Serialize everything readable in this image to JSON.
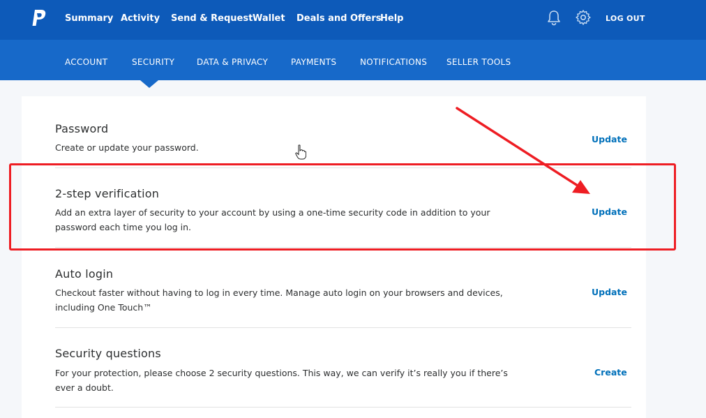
{
  "topnav": {
    "logo_icon": "paypal-logo",
    "items": [
      "Summary",
      "Activity",
      "Send & Request",
      "Wallet",
      "Deals and Offers",
      "Help"
    ],
    "bell_icon": "bell-icon",
    "gear_icon": "gear-icon",
    "logout": "LOG OUT"
  },
  "subnav": {
    "tabs": [
      "ACCOUNT",
      "SECURITY",
      "DATA & PRIVACY",
      "PAYMENTS",
      "NOTIFICATIONS",
      "SELLER TOOLS"
    ],
    "active": "SECURITY"
  },
  "settings": {
    "rows": [
      {
        "title": "Password",
        "desc": "Create or update your password.",
        "action": "Update"
      },
      {
        "title": "2-step verification",
        "desc": "Add an extra layer of security to your account by using a one-time security code in addition to your password each time you log in.",
        "action": "Update"
      },
      {
        "title": "Auto login",
        "desc": "Checkout faster without having to log in every time. Manage auto login on your browsers and devices, including One Touch™",
        "action": "Update"
      },
      {
        "title": "Security questions",
        "desc": "For your protection, please choose 2 security questions. This way, we can verify it’s really you if there’s ever a doubt.",
        "action": "Create"
      }
    ]
  },
  "colors": {
    "topnav": "#0d5ab9",
    "subnav": "#1769c9",
    "link": "#0070ba",
    "annotation": "#ee1d23"
  }
}
